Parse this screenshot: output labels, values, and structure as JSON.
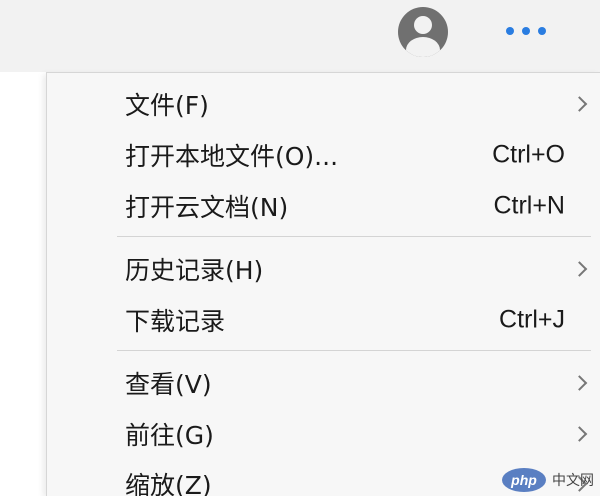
{
  "menu": {
    "items": [
      {
        "label": "文件(F)",
        "shortcut": "",
        "submenu": true
      },
      {
        "label": "打开本地文件(O)...",
        "shortcut": "Ctrl+O",
        "submenu": false
      },
      {
        "label": "打开云文档(N)",
        "shortcut": "Ctrl+N",
        "submenu": false
      },
      {
        "label": "历史记录(H)",
        "shortcut": "",
        "submenu": true
      },
      {
        "label": "下载记录",
        "shortcut": "Ctrl+J",
        "submenu": false
      },
      {
        "label": "查看(V)",
        "shortcut": "",
        "submenu": true
      },
      {
        "label": "前往(G)",
        "shortcut": "",
        "submenu": true
      },
      {
        "label": "缩放(Z)",
        "shortcut": "",
        "submenu": true
      }
    ]
  },
  "topbar": {
    "avatar_icon": "user-avatar-icon",
    "more_icon": "more-horizontal-icon",
    "accent_color": "#2a7de1"
  },
  "watermark": {
    "logo": "php",
    "text": "中文网"
  }
}
